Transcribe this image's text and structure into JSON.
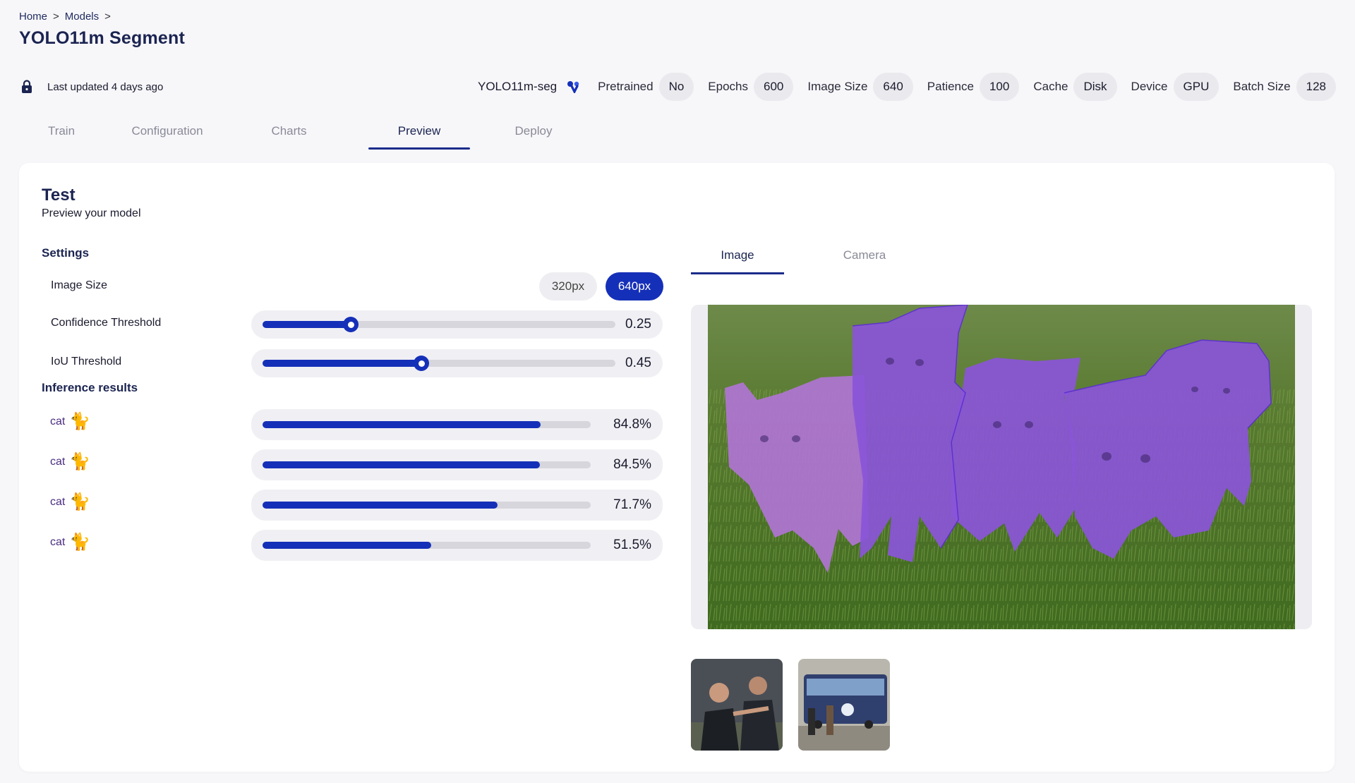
{
  "breadcrumb": {
    "items": [
      "Home",
      "Models"
    ],
    "sep": ">"
  },
  "page_title": "YOLO11m Segment",
  "meta": {
    "updated": "Last updated 4 days ago",
    "model_name": "YOLO11m-seg",
    "params": [
      {
        "label": "Pretrained",
        "value": "No"
      },
      {
        "label": "Epochs",
        "value": "600"
      },
      {
        "label": "Image Size",
        "value": "640"
      },
      {
        "label": "Patience",
        "value": "100"
      },
      {
        "label": "Cache",
        "value": "Disk"
      },
      {
        "label": "Device",
        "value": "GPU"
      },
      {
        "label": "Batch Size",
        "value": "128"
      }
    ]
  },
  "tabs": [
    {
      "label": "Train",
      "active": false
    },
    {
      "label": "Configuration",
      "active": false
    },
    {
      "label": "Charts",
      "active": false
    },
    {
      "label": "Preview",
      "active": true
    },
    {
      "label": "Deploy",
      "active": false
    }
  ],
  "test": {
    "title": "Test",
    "subtitle": "Preview your model",
    "settings_heading": "Settings",
    "image_size": {
      "label": "Image Size",
      "options": [
        "320px",
        "640px"
      ],
      "selected": "640px"
    },
    "confidence": {
      "label": "Confidence Threshold",
      "value": 0.25,
      "value_text": "0.25"
    },
    "iou": {
      "label": "IoU Threshold",
      "value": 0.45,
      "value_text": "0.45"
    },
    "results_heading": "Inference results",
    "results": [
      {
        "label": "cat",
        "icon": "cat-icon",
        "value": 0.848,
        "value_text": "84.8%"
      },
      {
        "label": "cat",
        "icon": "cat-icon",
        "value": 0.845,
        "value_text": "84.5%"
      },
      {
        "label": "cat",
        "icon": "cat-icon",
        "value": 0.717,
        "value_text": "71.7%"
      },
      {
        "label": "cat",
        "icon": "cat-icon",
        "value": 0.515,
        "value_text": "51.5%"
      }
    ]
  },
  "preview": {
    "tabs": [
      {
        "label": "Image",
        "active": true
      },
      {
        "label": "Camera",
        "active": false
      }
    ]
  },
  "colors": {
    "accent": "#1530b8",
    "mask": "#7b4fe0",
    "grass": "#4f7a2a"
  }
}
